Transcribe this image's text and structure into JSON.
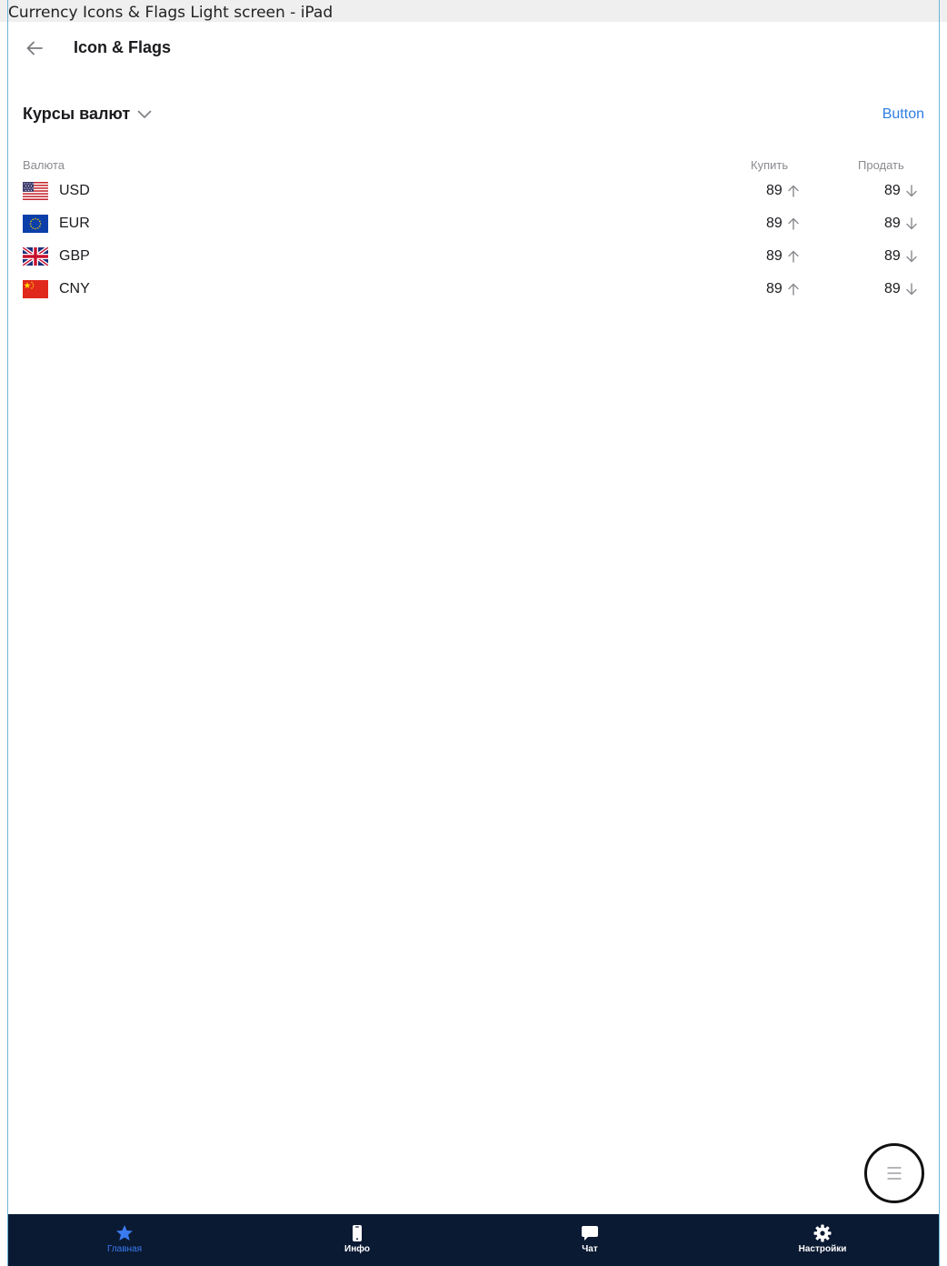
{
  "window": {
    "caption": "Currency Icons & Flags Light screen - iPad"
  },
  "header": {
    "title": "Icon & Flags"
  },
  "section": {
    "title": "Курсы валют",
    "action_label": "Button"
  },
  "table": {
    "columns": {
      "currency": "Валюта",
      "buy": "Купить",
      "sell": "Продать"
    },
    "rows": [
      {
        "code": "USD",
        "flag": "us-flag-icon",
        "buy": "89",
        "sell": "89"
      },
      {
        "code": "EUR",
        "flag": "eu-flag-icon",
        "buy": "89",
        "sell": "89"
      },
      {
        "code": "GBP",
        "flag": "uk-flag-icon",
        "buy": "89",
        "sell": "89"
      },
      {
        "code": "CNY",
        "flag": "cn-flag-icon",
        "buy": "89",
        "sell": "89"
      }
    ]
  },
  "tabbar": {
    "items": [
      {
        "label": "Главная",
        "icon": "star-icon",
        "active": true
      },
      {
        "label": "Инфо",
        "icon": "phone-icon",
        "active": false
      },
      {
        "label": "Чат",
        "icon": "chat-icon",
        "active": false
      },
      {
        "label": "Настройки",
        "icon": "gear-icon",
        "active": false
      }
    ]
  },
  "colors": {
    "accent": "#2f7de1",
    "tabbar_bg": "#0b1a33",
    "active_tab": "#3a7bf2",
    "muted": "#8a8a90"
  }
}
